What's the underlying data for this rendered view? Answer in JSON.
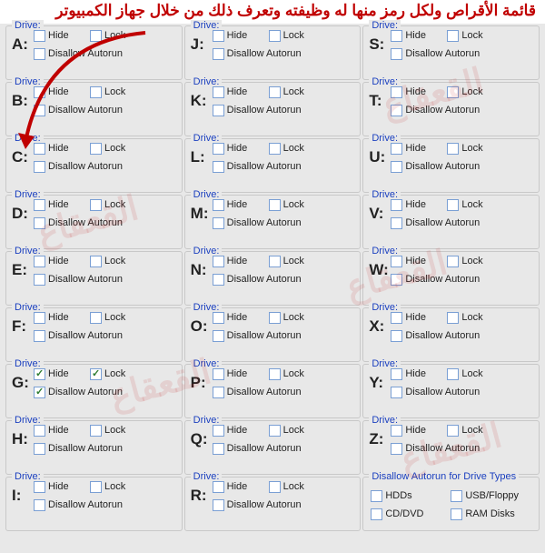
{
  "header": "قائمة الأقراص ولكل رمز منها له وظيفته وتعرف ذلك من خلال جهاز الكمبيوتر",
  "labels": {
    "drive": "Drive:",
    "hide": "Hide",
    "lock": "Lock",
    "disallow": "Disallow Autorun"
  },
  "drives": [
    {
      "letter": "A:",
      "hide": false,
      "lock": false,
      "disallow": false
    },
    {
      "letter": "J:",
      "hide": false,
      "lock": false,
      "disallow": false
    },
    {
      "letter": "S:",
      "hide": false,
      "lock": false,
      "disallow": false
    },
    {
      "letter": "B:",
      "hide": false,
      "lock": false,
      "disallow": false
    },
    {
      "letter": "K:",
      "hide": false,
      "lock": false,
      "disallow": false
    },
    {
      "letter": "T:",
      "hide": false,
      "lock": false,
      "disallow": false
    },
    {
      "letter": "C:",
      "hide": false,
      "lock": false,
      "disallow": false
    },
    {
      "letter": "L:",
      "hide": false,
      "lock": false,
      "disallow": false
    },
    {
      "letter": "U:",
      "hide": false,
      "lock": false,
      "disallow": false
    },
    {
      "letter": "D:",
      "hide": false,
      "lock": false,
      "disallow": false
    },
    {
      "letter": "M:",
      "hide": false,
      "lock": false,
      "disallow": false
    },
    {
      "letter": "V:",
      "hide": false,
      "lock": false,
      "disallow": false
    },
    {
      "letter": "E:",
      "hide": false,
      "lock": false,
      "disallow": false
    },
    {
      "letter": "N:",
      "hide": false,
      "lock": false,
      "disallow": false
    },
    {
      "letter": "W:",
      "hide": false,
      "lock": false,
      "disallow": false
    },
    {
      "letter": "F:",
      "hide": false,
      "lock": false,
      "disallow": false
    },
    {
      "letter": "O:",
      "hide": false,
      "lock": false,
      "disallow": false
    },
    {
      "letter": "X:",
      "hide": false,
      "lock": false,
      "disallow": false
    },
    {
      "letter": "G:",
      "hide": true,
      "lock": true,
      "disallow": true
    },
    {
      "letter": "P:",
      "hide": false,
      "lock": false,
      "disallow": false
    },
    {
      "letter": "Y:",
      "hide": false,
      "lock": false,
      "disallow": false
    },
    {
      "letter": "H:",
      "hide": false,
      "lock": false,
      "disallow": false
    },
    {
      "letter": "Q:",
      "hide": false,
      "lock": false,
      "disallow": false
    },
    {
      "letter": "Z:",
      "hide": false,
      "lock": false,
      "disallow": false
    },
    {
      "letter": "I:",
      "hide": false,
      "lock": false,
      "disallow": false
    },
    {
      "letter": "R:",
      "hide": false,
      "lock": false,
      "disallow": false
    }
  ],
  "driveTypes": {
    "legend": "Disallow Autorun for Drive Types",
    "items": [
      {
        "label": "HDDs",
        "checked": false
      },
      {
        "label": "USB/Floppy",
        "checked": false
      },
      {
        "label": "CD/DVD",
        "checked": false
      },
      {
        "label": "RAM Disks",
        "checked": false
      }
    ]
  },
  "watermark": "القعقاع"
}
